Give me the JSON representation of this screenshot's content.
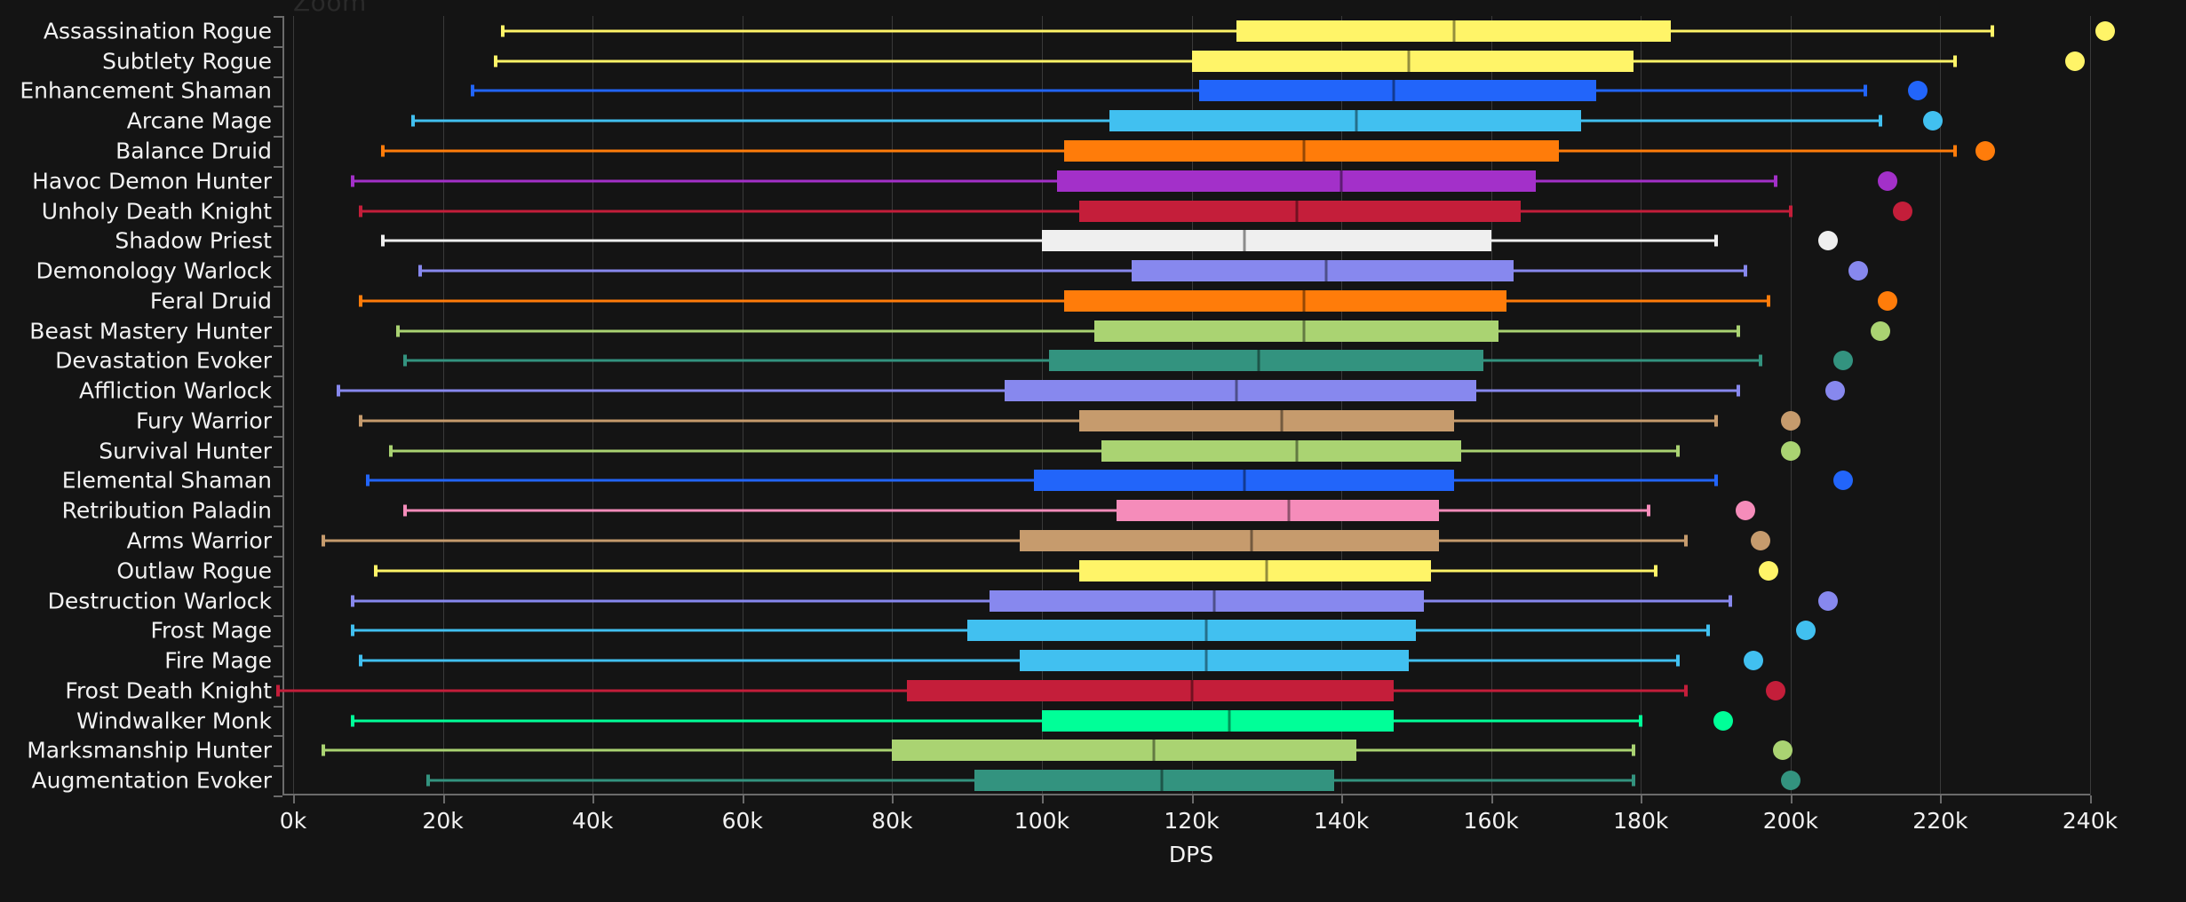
{
  "chart_data": {
    "type": "box",
    "title": "Zoom",
    "xlabel": "DPS",
    "ylabel": "",
    "xlim": [
      -5000,
      245000
    ],
    "xticks": [
      0,
      20000,
      40000,
      60000,
      80000,
      100000,
      120000,
      140000,
      160000,
      180000,
      200000,
      220000,
      240000
    ],
    "xticklabels": [
      "0k",
      "20k",
      "40k",
      "60k",
      "80k",
      "100k",
      "120k",
      "140k",
      "160k",
      "180k",
      "200k",
      "220k",
      "240k"
    ],
    "grid": "vertical",
    "background": "#141414",
    "categories": [
      "Assassination Rogue",
      "Subtlety Rogue",
      "Enhancement Shaman",
      "Arcane Mage",
      "Balance Druid",
      "Havoc Demon Hunter",
      "Unholy Death Knight",
      "Shadow Priest",
      "Demonology Warlock",
      "Feral Druid",
      "Beast Mastery Hunter",
      "Devastation Evoker",
      "Affliction Warlock",
      "Fury Warrior",
      "Survival Hunter",
      "Elemental Shaman",
      "Retribution Paladin",
      "Arms Warrior",
      "Outlaw Rogue",
      "Destruction Warlock",
      "Frost Mage",
      "Fire Mage",
      "Frost Death Knight",
      "Windwalker Monk",
      "Marksmanship Hunter",
      "Augmentation Evoker"
    ],
    "boxes": [
      {
        "spec": "Assassination Rogue",
        "color": "#fff468",
        "whisker_low": 28000,
        "q1": 126000,
        "median": 155000,
        "q3": 184000,
        "whisker_high": 227000,
        "outliers": [
          242000
        ]
      },
      {
        "spec": "Subtlety Rogue",
        "color": "#fff468",
        "whisker_low": 27000,
        "q1": 120000,
        "median": 149000,
        "q3": 179000,
        "whisker_high": 222000,
        "outliers": [
          238000
        ]
      },
      {
        "spec": "Enhancement Shaman",
        "color": "#2265fa",
        "whisker_low": 24000,
        "q1": 121000,
        "median": 147000,
        "q3": 174000,
        "whisker_high": 210000,
        "outliers": [
          217000
        ]
      },
      {
        "spec": "Arcane Mage",
        "color": "#41c0f0",
        "whisker_low": 16000,
        "q1": 109000,
        "median": 142000,
        "q3": 172000,
        "whisker_high": 212000,
        "outliers": [
          219000
        ]
      },
      {
        "spec": "Balance Druid",
        "color": "#ff7c0a",
        "whisker_low": 12000,
        "q1": 103000,
        "median": 135000,
        "q3": 169000,
        "whisker_high": 222000,
        "outliers": [
          226000
        ]
      },
      {
        "spec": "Havoc Demon Hunter",
        "color": "#a330c9",
        "whisker_low": 8000,
        "q1": 102000,
        "median": 140000,
        "q3": 166000,
        "whisker_high": 198000,
        "outliers": [
          213000
        ]
      },
      {
        "spec": "Unholy Death Knight",
        "color": "#c41e3a",
        "whisker_low": 9000,
        "q1": 105000,
        "median": 134000,
        "q3": 164000,
        "whisker_high": 200000,
        "outliers": [
          215000
        ]
      },
      {
        "spec": "Shadow Priest",
        "color": "#efefef",
        "whisker_low": 12000,
        "q1": 100000,
        "median": 127000,
        "q3": 160000,
        "whisker_high": 190000,
        "outliers": [
          205000
        ]
      },
      {
        "spec": "Demonology Warlock",
        "color": "#8788ee",
        "whisker_low": 17000,
        "q1": 112000,
        "median": 138000,
        "q3": 163000,
        "whisker_high": 194000,
        "outliers": [
          209000
        ]
      },
      {
        "spec": "Feral Druid",
        "color": "#ff7c0a",
        "whisker_low": 9000,
        "q1": 103000,
        "median": 135000,
        "q3": 162000,
        "whisker_high": 197000,
        "outliers": [
          213000
        ]
      },
      {
        "spec": "Beast Mastery Hunter",
        "color": "#aad372",
        "whisker_low": 14000,
        "q1": 107000,
        "median": 135000,
        "q3": 161000,
        "whisker_high": 193000,
        "outliers": [
          212000
        ]
      },
      {
        "spec": "Devastation Evoker",
        "color": "#33937f",
        "whisker_low": 15000,
        "q1": 101000,
        "median": 129000,
        "q3": 159000,
        "whisker_high": 196000,
        "outliers": [
          207000
        ]
      },
      {
        "spec": "Affliction Warlock",
        "color": "#8788ee",
        "whisker_low": 6000,
        "q1": 95000,
        "median": 126000,
        "q3": 158000,
        "whisker_high": 193000,
        "outliers": [
          206000
        ]
      },
      {
        "spec": "Fury Warrior",
        "color": "#c69b6d",
        "whisker_low": 9000,
        "q1": 105000,
        "median": 132000,
        "q3": 155000,
        "whisker_high": 190000,
        "outliers": [
          200000
        ]
      },
      {
        "spec": "Survival Hunter",
        "color": "#aad372",
        "whisker_low": 13000,
        "q1": 108000,
        "median": 134000,
        "q3": 156000,
        "whisker_high": 185000,
        "outliers": [
          200000
        ]
      },
      {
        "spec": "Elemental Shaman",
        "color": "#2265fa",
        "whisker_low": 10000,
        "q1": 99000,
        "median": 127000,
        "q3": 155000,
        "whisker_high": 190000,
        "outliers": [
          207000
        ]
      },
      {
        "spec": "Retribution Paladin",
        "color": "#f58cba",
        "whisker_low": 15000,
        "q1": 110000,
        "median": 133000,
        "q3": 153000,
        "whisker_high": 181000,
        "outliers": [
          194000
        ]
      },
      {
        "spec": "Arms Warrior",
        "color": "#c69b6d",
        "whisker_low": 4000,
        "q1": 97000,
        "median": 128000,
        "q3": 153000,
        "whisker_high": 186000,
        "outliers": [
          196000
        ]
      },
      {
        "spec": "Outlaw Rogue",
        "color": "#fff468",
        "whisker_low": 11000,
        "q1": 105000,
        "median": 130000,
        "q3": 152000,
        "whisker_high": 182000,
        "outliers": [
          197000
        ]
      },
      {
        "spec": "Destruction Warlock",
        "color": "#8788ee",
        "whisker_low": 8000,
        "q1": 93000,
        "median": 123000,
        "q3": 151000,
        "whisker_high": 192000,
        "outliers": [
          205000
        ]
      },
      {
        "spec": "Frost Mage",
        "color": "#41c0f0",
        "whisker_low": 8000,
        "q1": 90000,
        "median": 122000,
        "q3": 150000,
        "whisker_high": 189000,
        "outliers": [
          202000
        ]
      },
      {
        "spec": "Fire Mage",
        "color": "#41c0f0",
        "whisker_low": 9000,
        "q1": 97000,
        "median": 122000,
        "q3": 149000,
        "whisker_high": 185000,
        "outliers": [
          195000
        ]
      },
      {
        "spec": "Frost Death Knight",
        "color": "#c41e3a",
        "whisker_low": -2000,
        "q1": 82000,
        "median": 120000,
        "q3": 147000,
        "whisker_high": 186000,
        "outliers": [
          198000
        ]
      },
      {
        "spec": "Windwalker Monk",
        "color": "#00ff98",
        "whisker_low": 8000,
        "q1": 100000,
        "median": 125000,
        "q3": 147000,
        "whisker_high": 180000,
        "outliers": [
          191000
        ]
      },
      {
        "spec": "Marksmanship Hunter",
        "color": "#aad372",
        "whisker_low": 4000,
        "q1": 80000,
        "median": 115000,
        "q3": 142000,
        "whisker_high": 179000,
        "outliers": [
          199000
        ]
      },
      {
        "spec": "Augmentation Evoker",
        "color": "#33937f",
        "whisker_low": 18000,
        "q1": 91000,
        "median": 116000,
        "q3": 139000,
        "whisker_high": 179000,
        "outliers": [
          200000
        ]
      }
    ]
  }
}
